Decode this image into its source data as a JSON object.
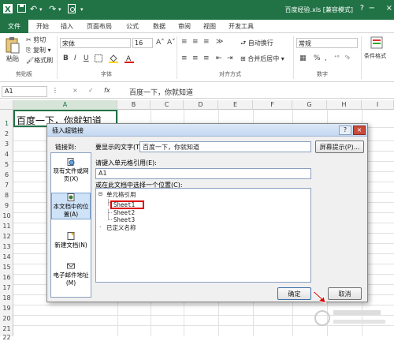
{
  "window": {
    "title": "百度经验.xls [兼容模式]",
    "minimize": "−",
    "restore": "□",
    "close": "×"
  },
  "ribbon_tabs": [
    {
      "label": "文件"
    },
    {
      "label": "开始"
    },
    {
      "label": "插入"
    },
    {
      "label": "页面布局"
    },
    {
      "label": "公式"
    },
    {
      "label": "数据"
    },
    {
      "label": "审阅"
    },
    {
      "label": "视图"
    },
    {
      "label": "开发工具"
    }
  ],
  "ribbon": {
    "clipboard": {
      "paste": "粘贴",
      "cut": "剪切",
      "copy": "复制 ▾",
      "format_painter": "格式刷",
      "group": "剪贴板"
    },
    "font": {
      "name": "宋体",
      "size": "16",
      "bold": "B",
      "italic": "I",
      "underline": "U",
      "group": "字体",
      "grow": "A˄",
      "shrink": "A˅"
    },
    "alignment": {
      "wrap": "自动换行",
      "merge": "合并后居中 ▾",
      "group": "对齐方式"
    },
    "number": {
      "format": "常规",
      "percent": "%",
      "comma": ",",
      "group": "数字"
    },
    "styles": {
      "conditional": "条件格式"
    }
  },
  "formula_bar": {
    "name_box": "A1",
    "cancel": "×",
    "enter": "✓",
    "fx": "fx",
    "value": "百度一下，你就知道"
  },
  "grid": {
    "columns": [
      "A",
      "B",
      "C",
      "D",
      "E",
      "F",
      "G",
      "H",
      "I"
    ],
    "rows": [
      "1",
      "2",
      "3",
      "4",
      "5",
      "6",
      "7",
      "8",
      "9",
      "10",
      "11",
      "12",
      "13",
      "14",
      "15",
      "16",
      "17",
      "18",
      "19",
      "20",
      "21",
      "22"
    ],
    "a1_value": "百度一下，你就知道"
  },
  "dialog": {
    "title": "插入超链接",
    "help": "?",
    "close": "×",
    "link_to_label": "链接到:",
    "display_text_label": "要显示的文字(T):",
    "display_text_value": "百度一下，你就知道",
    "screentip_button": "屏幕提示(P)...",
    "cell_ref_label": "请键入单元格引用(E):",
    "cell_ref_value": "A1",
    "place_label": "或在此文档中选择一个位置(C):",
    "link_targets": [
      {
        "label": "现有文件或网页(X)"
      },
      {
        "label": "本文档中的位置(A)"
      },
      {
        "label": "新建文档(N)"
      },
      {
        "label": "电子邮件地址(M)"
      }
    ],
    "tree": {
      "root": "单元格引用",
      "sheets": [
        "Sheet1",
        "Sheet2",
        "Sheet3"
      ],
      "defined_names": "已定义名称"
    },
    "ok": "确定",
    "cancel": "取消"
  },
  "colors": {
    "excel_green": "#217346",
    "selection_red": "#d00000"
  }
}
